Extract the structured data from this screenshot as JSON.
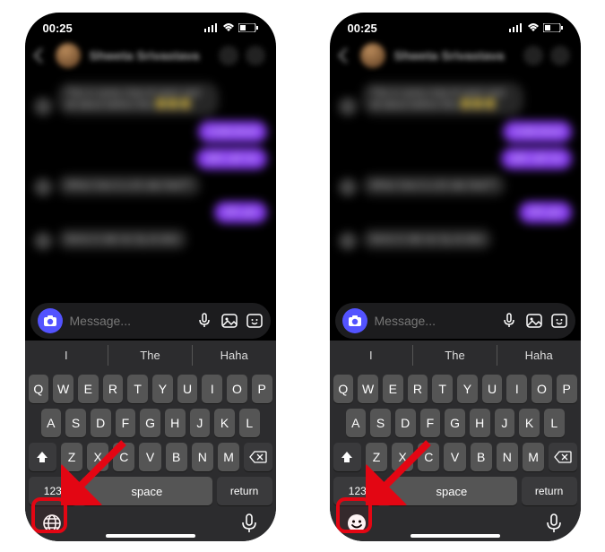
{
  "status": {
    "time": "00:25"
  },
  "chat": {
    "contact_name": "Shweta Srivastava",
    "messages_hint": "blurred chat bubbles"
  },
  "composer": {
    "placeholder": "Message..."
  },
  "keyboard": {
    "suggestions": [
      "I",
      "The",
      "Haha"
    ],
    "row1": [
      "Q",
      "W",
      "E",
      "R",
      "T",
      "Y",
      "U",
      "I",
      "O",
      "P"
    ],
    "row2": [
      "A",
      "S",
      "D",
      "F",
      "G",
      "H",
      "J",
      "K",
      "L"
    ],
    "row3": [
      "Z",
      "X",
      "C",
      "V",
      "B",
      "N",
      "M"
    ],
    "num_label": "123",
    "space_label": "space",
    "return_label": "return"
  },
  "left": {
    "switch_icon": "globe"
  },
  "right": {
    "switch_icon": "emoji"
  }
}
